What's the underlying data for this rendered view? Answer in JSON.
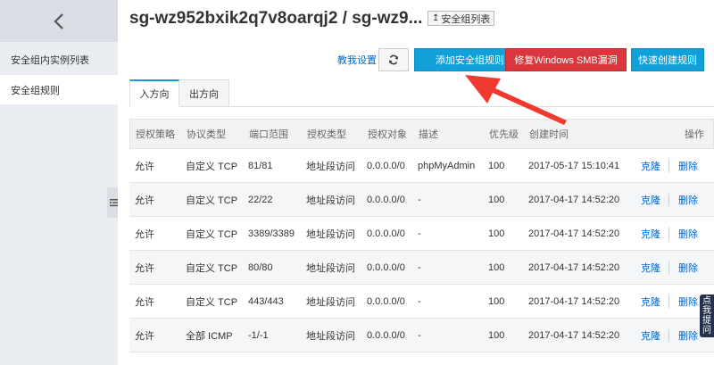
{
  "sidebar": {
    "back_icon": "chevron-left-icon",
    "items": [
      {
        "label": "安全组内实例列表"
      },
      {
        "label": "安全组规则"
      }
    ]
  },
  "header": {
    "title": "sg-wz952bxik2q7v8oarqj2 / sg-wz9...",
    "back_list_label": "安全组列表"
  },
  "toolbar": {
    "tutorial_label": "教我设置",
    "add_rule_label": "添加安全组规则",
    "fix_smb_label": "修复Windows SMB漏洞",
    "quick_create_label": "快速创建规则"
  },
  "tabs": [
    {
      "label": "入方向",
      "active": true
    },
    {
      "label": "出方向",
      "active": false
    }
  ],
  "table": {
    "columns": [
      "授权策略",
      "协议类型",
      "端口范围",
      "授权类型",
      "授权对象",
      "描述",
      "优先级",
      "创建时间",
      "操作"
    ],
    "rows": [
      {
        "policy": "允许",
        "protocol": "自定义 TCP",
        "port": "81/81",
        "auth_type": "地址段访问",
        "object": "0.0.0.0/0",
        "desc": "phpMyAdmin",
        "priority": "100",
        "created": "2017-05-17 15:10:41",
        "clone": "克隆",
        "delete": "删除"
      },
      {
        "policy": "允许",
        "protocol": "自定义 TCP",
        "port": "22/22",
        "auth_type": "地址段访问",
        "object": "0.0.0.0/0",
        "desc": "-",
        "priority": "100",
        "created": "2017-04-17 14:52:20",
        "clone": "克隆",
        "delete": "删除"
      },
      {
        "policy": "允许",
        "protocol": "自定义 TCP",
        "port": "3389/3389",
        "auth_type": "地址段访问",
        "object": "0.0.0.0/0",
        "desc": "-",
        "priority": "100",
        "created": "2017-04-17 14:52:20",
        "clone": "克隆",
        "delete": "删除"
      },
      {
        "policy": "允许",
        "protocol": "自定义 TCP",
        "port": "80/80",
        "auth_type": "地址段访问",
        "object": "0.0.0.0/0",
        "desc": "-",
        "priority": "100",
        "created": "2017-04-17 14:52:20",
        "clone": "克隆",
        "delete": "删除"
      },
      {
        "policy": "允许",
        "protocol": "自定义 TCP",
        "port": "443/443",
        "auth_type": "地址段访问",
        "object": "0.0.0.0/0",
        "desc": "-",
        "priority": "100",
        "created": "2017-04-17 14:52:20",
        "clone": "克隆",
        "delete": "删除"
      },
      {
        "policy": "允许",
        "protocol": "全部 ICMP",
        "port": "-1/-1",
        "auth_type": "地址段访问",
        "object": "0.0.0.0/0",
        "desc": "-",
        "priority": "100",
        "created": "2017-04-17 14:52:20",
        "clone": "克隆",
        "delete": "删除"
      }
    ]
  },
  "float_tab_label": "点我提问",
  "colors": {
    "primary": "#11a0d8",
    "danger": "#d9363e",
    "arrow": "#f03a30",
    "sidebar_bg": "#eaedf1"
  }
}
